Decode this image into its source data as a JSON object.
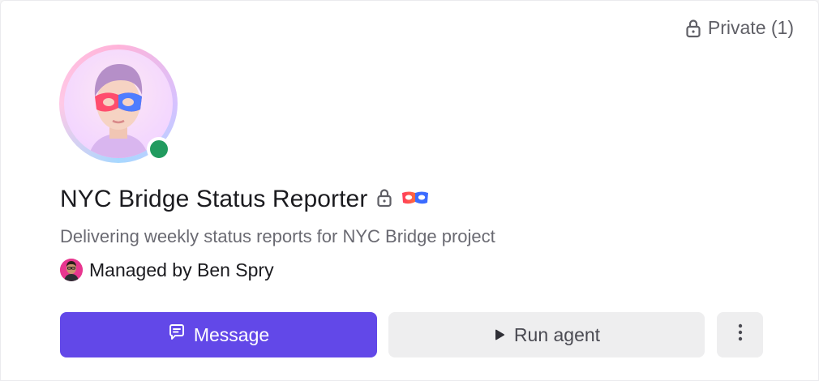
{
  "privacy": {
    "icon": "lock-icon",
    "label": "Private (1)"
  },
  "agent": {
    "name": "NYC Bridge Status Reporter",
    "description": "Delivering weekly status reports for NYC Bridge project",
    "status": "online",
    "status_color": "#219b5f"
  },
  "manager": {
    "label": "Managed by Ben Spry"
  },
  "actions": {
    "message_label": "Message",
    "run_label": "Run agent",
    "more_icon": "more-vertical-icon"
  },
  "colors": {
    "accent": "#6248e8",
    "secondary_button": "#eeeeef"
  }
}
